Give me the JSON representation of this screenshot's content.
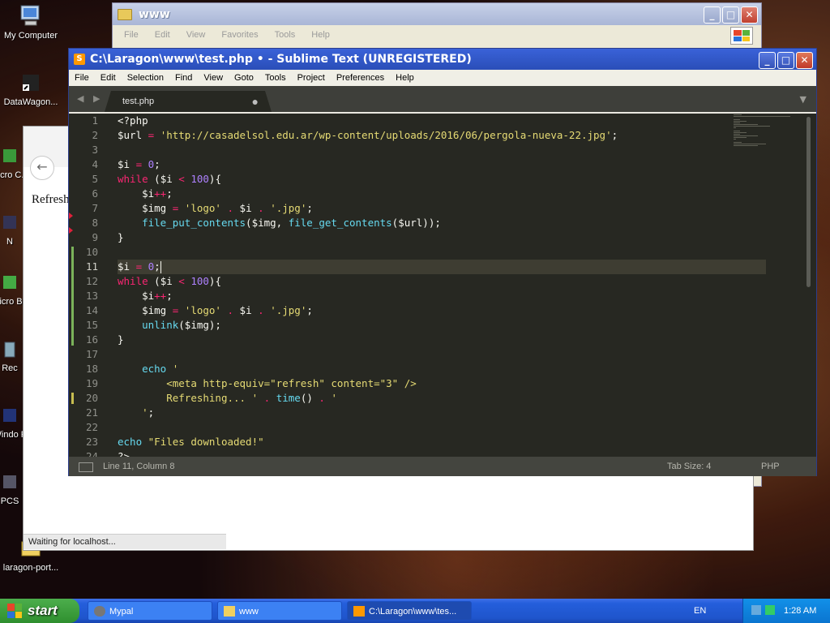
{
  "desktop": {
    "icons": [
      {
        "label": "My Computer"
      },
      {
        "label": "DataWagon..."
      },
      {
        "label": "Micro C..."
      },
      {
        "label": "N"
      },
      {
        "label": "Micro Ba"
      },
      {
        "label": "Rec"
      },
      {
        "label": "Windo F"
      },
      {
        "label": "PCS"
      },
      {
        "label": "laragon-port..."
      }
    ]
  },
  "explorer": {
    "title": "www",
    "menu": [
      "File",
      "Edit",
      "View",
      "Favorites",
      "Tools",
      "Help"
    ]
  },
  "browser": {
    "body_text": "Refresh",
    "status_text": "Waiting for localhost..."
  },
  "sublime": {
    "title": "C:\\Laragon\\www\\test.php • - Sublime Text (UNREGISTERED)",
    "menu": [
      "File",
      "Edit",
      "Selection",
      "Find",
      "View",
      "Goto",
      "Tools",
      "Project",
      "Preferences",
      "Help"
    ],
    "tab": {
      "name": "test.php",
      "dirty_marker": "●"
    },
    "line_numbers": [
      "1",
      "2",
      "3",
      "4",
      "5",
      "6",
      "7",
      "8",
      "9",
      "10",
      "11",
      "12",
      "13",
      "14",
      "15",
      "16",
      "17",
      "18",
      "19",
      "20",
      "21",
      "22",
      "23",
      "24"
    ],
    "status": {
      "position": "Line 11, Column 8",
      "tab_size": "Tab Size: 4",
      "syntax": "PHP"
    }
  },
  "taskbar": {
    "start_label": "start",
    "tasks": [
      {
        "label": "Mypal"
      },
      {
        "label": "www"
      },
      {
        "label": "C:\\Laragon\\www\\tes..."
      }
    ],
    "language": "EN",
    "clock": "1:28 AM"
  }
}
